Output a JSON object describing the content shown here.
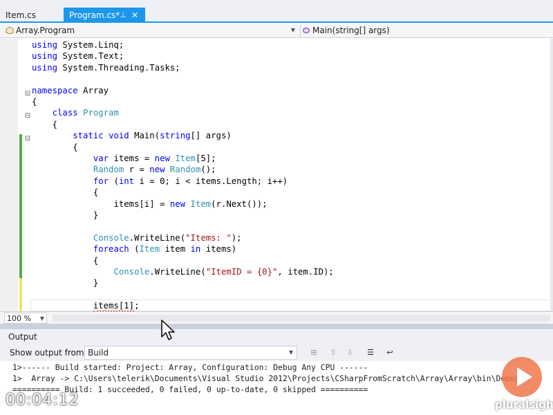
{
  "tabs": [
    {
      "label": "Item.cs",
      "active": false
    },
    {
      "label": "Program.cs*",
      "active": true,
      "pin": "⊥",
      "close": "✕"
    }
  ],
  "navbar": {
    "type_dropdown": "Array.Program",
    "member_dropdown": "Main(string[] args)"
  },
  "editor": {
    "lines": [
      [
        {
          "t": "using",
          "c": "kw"
        },
        {
          "t": " System.Linq;"
        }
      ],
      [
        {
          "t": "using",
          "c": "kw"
        },
        {
          "t": " System.Text;"
        }
      ],
      [
        {
          "t": "using",
          "c": "kw"
        },
        {
          "t": " System.Threading.Tasks;"
        }
      ],
      [],
      [
        {
          "t": "namespace",
          "c": "kw"
        },
        {
          "t": " Array"
        }
      ],
      [
        {
          "t": "{"
        }
      ],
      [
        {
          "t": "    "
        },
        {
          "t": "class",
          "c": "kw"
        },
        {
          "t": " "
        },
        {
          "t": "Program",
          "c": "ty"
        }
      ],
      [
        {
          "t": "    {"
        }
      ],
      [
        {
          "t": "        "
        },
        {
          "t": "static",
          "c": "kw"
        },
        {
          "t": " "
        },
        {
          "t": "void",
          "c": "kw"
        },
        {
          "t": " Main("
        },
        {
          "t": "string",
          "c": "kw"
        },
        {
          "t": "[] args)"
        }
      ],
      [
        {
          "t": "        {"
        }
      ],
      [
        {
          "t": "            "
        },
        {
          "t": "var",
          "c": "kw"
        },
        {
          "t": " items = "
        },
        {
          "t": "new",
          "c": "kw"
        },
        {
          "t": " "
        },
        {
          "t": "Item",
          "c": "ty"
        },
        {
          "t": "[5];"
        }
      ],
      [
        {
          "t": "            "
        },
        {
          "t": "Random",
          "c": "ty"
        },
        {
          "t": " r = "
        },
        {
          "t": "new",
          "c": "kw"
        },
        {
          "t": " "
        },
        {
          "t": "Random",
          "c": "ty"
        },
        {
          "t": "();"
        }
      ],
      [
        {
          "t": "            "
        },
        {
          "t": "for",
          "c": "kw"
        },
        {
          "t": " ("
        },
        {
          "t": "int",
          "c": "kw"
        },
        {
          "t": " i = 0; i < items.Length; i++)"
        }
      ],
      [
        {
          "t": "            {"
        }
      ],
      [
        {
          "t": "                items[i] = "
        },
        {
          "t": "new",
          "c": "kw"
        },
        {
          "t": " "
        },
        {
          "t": "Item",
          "c": "ty"
        },
        {
          "t": "(r.Next());"
        }
      ],
      [
        {
          "t": "            }"
        }
      ],
      [],
      [
        {
          "t": "            "
        },
        {
          "t": "Console",
          "c": "ty"
        },
        {
          "t": ".WriteLine("
        },
        {
          "t": "\"Items: \"",
          "c": "st"
        },
        {
          "t": ");"
        }
      ],
      [
        {
          "t": "            "
        },
        {
          "t": "foreach",
          "c": "kw"
        },
        {
          "t": " ("
        },
        {
          "t": "Item",
          "c": "ty"
        },
        {
          "t": " item "
        },
        {
          "t": "in",
          "c": "kw"
        },
        {
          "t": " items)"
        }
      ],
      [
        {
          "t": "            {"
        }
      ],
      [
        {
          "t": "                "
        },
        {
          "t": "Console",
          "c": "ty"
        },
        {
          "t": ".WriteLine("
        },
        {
          "t": "\"ItemID = {0}\"",
          "c": "st"
        },
        {
          "t": ", item.ID);"
        }
      ],
      [
        {
          "t": "            }"
        }
      ],
      [],
      [
        {
          "t": "            "
        },
        {
          "t": "items[1]",
          "c": "sq"
        },
        {
          "t": ";"
        }
      ]
    ]
  },
  "zoom": "100 %",
  "output": {
    "title": "Output",
    "show_label": "Show output from:",
    "source": "Build",
    "lines": [
      "1>------ Build started: Project: Array, Configuration: Debug Any CPU ------",
      "1>  Array -> C:\\Users\\telerik\\Documents\\Visual Studio 2012\\Projects\\CSharpFromScratch\\Array\\Array\\bin\\Debug\\A",
      "========== Build: 1 succeeded, 0 failed, 0 up-to-date, 0 skipped =========="
    ]
  },
  "video": {
    "timestamp": "00:04:12",
    "brand": "pluralsight"
  },
  "colors": {
    "accent": "#1c97ea",
    "keyword": "#0000ff",
    "type": "#2b91af",
    "string": "#a31515",
    "play": "#ee784b"
  }
}
